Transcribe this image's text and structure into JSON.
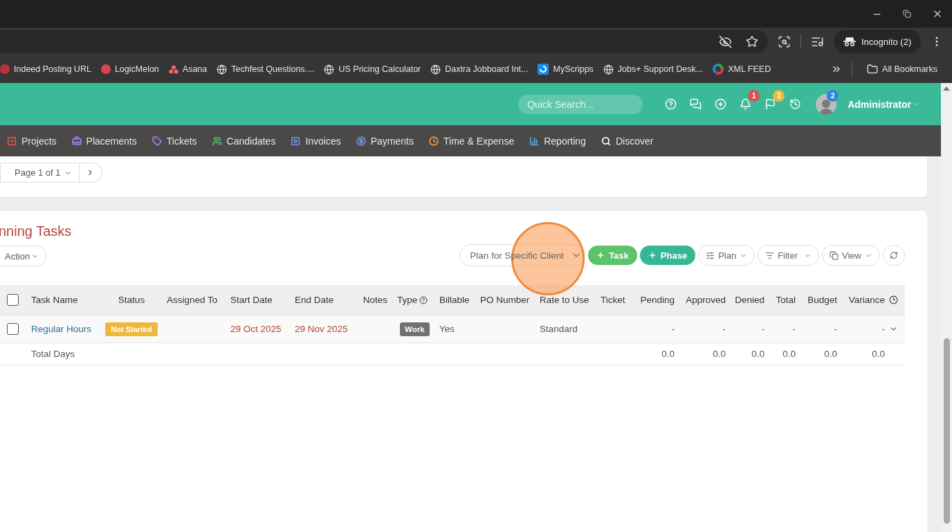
{
  "browser": {
    "incognito_label": "Incognito (2)",
    "all_bookmarks": "All Bookmarks",
    "bookmarks": [
      "Indeed Posting URL",
      "LogicMelon",
      "Asana",
      "Techfest Questions....",
      "US Pricing Calculator",
      "Daxtra Jobboard Int...",
      "MyScripps",
      "Jobs+ Support Desk...",
      "XML FEED"
    ]
  },
  "header": {
    "search_placeholder": "Quick Search...",
    "alerts_badge": "1",
    "flags_badge": "3",
    "user_badge": "2",
    "user_name": "Administrator"
  },
  "nav": [
    {
      "label": "Projects",
      "color": "#e0574f"
    },
    {
      "label": "Placements",
      "color": "#9b7fe0"
    },
    {
      "label": "Tickets",
      "color": "#9b7fe0"
    },
    {
      "label": "Candidates",
      "color": "#4fb86a"
    },
    {
      "label": "Invoices",
      "color": "#6f8fe0"
    },
    {
      "label": "Payments",
      "color": "#6f8fe0"
    },
    {
      "label": "Time & Expense",
      "color": "#f0964a"
    },
    {
      "label": "Reporting",
      "color": "#5aa8e0"
    },
    {
      "label": "Discover",
      "color": "#ffffff"
    }
  ],
  "pagination": {
    "page_label": "Page 1 of 1"
  },
  "tasks": {
    "title": "nning Tasks",
    "action_label": "Action",
    "plan_select": "Plan for Specific Client",
    "task_button": "Task",
    "phase_button": "Phase",
    "plan_button": "Plan",
    "filter_button": "Filter",
    "view_button": "View",
    "table": {
      "all_checked": false,
      "columns": [
        {
          "label": "Task Name"
        },
        {
          "label": "Status",
          "kind": "status"
        },
        {
          "label": "Assigned To"
        },
        {
          "label": "Start Date"
        },
        {
          "label": "End Date"
        },
        {
          "label": "Notes",
          "kind": "amount"
        },
        {
          "label": "Type",
          "help": true
        },
        {
          "label": "Billable"
        },
        {
          "label": "PO Number"
        },
        {
          "label": "Rate to Use"
        },
        {
          "label": "Ticket"
        },
        {
          "label": "Pending",
          "kind": "amount"
        },
        {
          "label": "Approved",
          "kind": "amount"
        },
        {
          "label": "Denied",
          "kind": "amount"
        },
        {
          "label": "Total",
          "kind": "amount"
        },
        {
          "label": "Budget",
          "kind": "amount"
        },
        {
          "label": "Variance",
          "kind": "amount"
        }
      ],
      "rows": [
        {
          "checked": false,
          "expandable": true,
          "cells": [
            {
              "kind": "link",
              "text": "Regular Hours"
            },
            {
              "kind": "badge",
              "text": "Not Started"
            },
            null,
            {
              "kind": "date",
              "text": "29 Oct 2025"
            },
            {
              "kind": "date",
              "text": "29 Nov 2025"
            },
            null,
            {
              "kind": "tag",
              "text": "Work"
            },
            {
              "kind": "text",
              "text": "Yes"
            },
            null,
            {
              "kind": "text",
              "text": "Standard"
            },
            null,
            {
              "kind": "text",
              "text": "-"
            },
            {
              "kind": "text",
              "text": "-"
            },
            {
              "kind": "text",
              "text": "-"
            },
            {
              "kind": "text",
              "text": "-"
            },
            {
              "kind": "text",
              "text": "-"
            },
            {
              "kind": "text",
              "text": "-"
            }
          ]
        }
      ],
      "total_row": {
        "cells": [
          {
            "kind": "text",
            "text": "Total Days"
          },
          null,
          null,
          null,
          null,
          null,
          null,
          null,
          null,
          null,
          null,
          {
            "kind": "text",
            "text": "0.0"
          },
          {
            "kind": "text",
            "text": "0.0"
          },
          {
            "kind": "text",
            "text": "0.0"
          },
          {
            "kind": "text",
            "text": "0.0"
          },
          {
            "kind": "text",
            "text": "0.0"
          },
          {
            "kind": "text",
            "text": "0.0"
          }
        ]
      }
    }
  }
}
